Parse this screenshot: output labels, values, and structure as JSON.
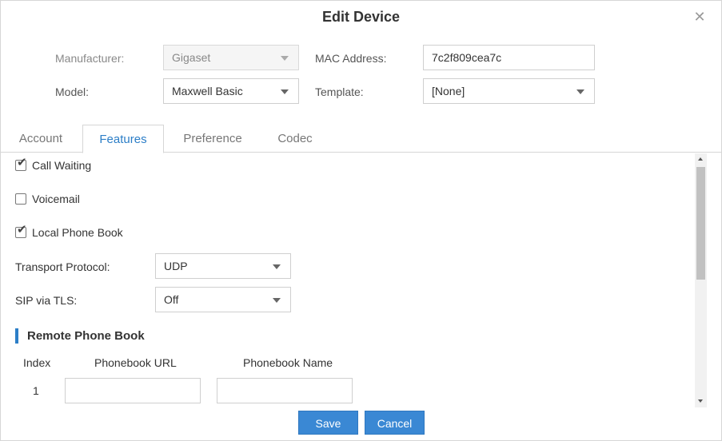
{
  "dialog": {
    "title": "Edit Device",
    "close_icon": "close-icon"
  },
  "device": {
    "manufacturer_label": "Manufacturer:",
    "manufacturer_value": "Gigaset",
    "mac_label": "MAC Address:",
    "mac_value": "7c2f809cea7c",
    "model_label": "Model:",
    "model_value": "Maxwell Basic",
    "template_label": "Template:",
    "template_value": "[None]"
  },
  "tabs": [
    {
      "label": "Account",
      "active": false
    },
    {
      "label": "Features",
      "active": true
    },
    {
      "label": "Preference",
      "active": false
    },
    {
      "label": "Codec",
      "active": false
    }
  ],
  "features": {
    "call_waiting": {
      "label": "Call Waiting",
      "checked": true
    },
    "voicemail": {
      "label": "Voicemail",
      "checked": false
    },
    "local_phone_book": {
      "label": "Local Phone Book",
      "checked": true
    },
    "transport_label": "Transport Protocol:",
    "transport_value": "UDP",
    "sip_tls_label": "SIP via TLS:",
    "sip_tls_value": "Off"
  },
  "remote_phone_book": {
    "title": "Remote Phone Book",
    "columns": [
      "Index",
      "Phonebook URL",
      "Phonebook Name"
    ],
    "rows": [
      {
        "index": "1",
        "url": "",
        "name": ""
      }
    ]
  },
  "buttons": {
    "save": "Save",
    "cancel": "Cancel"
  },
  "colors": {
    "accent": "#2c7ec7",
    "button": "#3a88d4"
  }
}
